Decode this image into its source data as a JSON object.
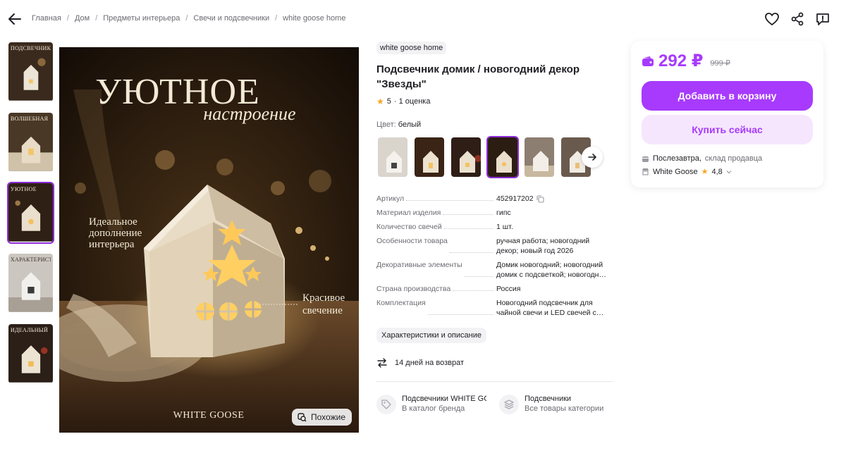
{
  "breadcrumb": [
    "Главная",
    "Дом",
    "Предметы интерьера",
    "Свечи и подсвечники",
    "white goose home"
  ],
  "thumbnails": [
    {
      "caption": "ПОДСВЕЧНИК ДОМИК"
    },
    {
      "caption": "ВОЛШЕБНАЯ"
    },
    {
      "caption": "УЮТНОЕ"
    },
    {
      "caption": "ХАРАКТЕРИСТИКИ"
    },
    {
      "caption": "ИДЕАЛЬНЫЙ"
    }
  ],
  "photo": {
    "headline": "УЮТНОЕ",
    "script": "настроение",
    "left_note": [
      "Идеальное",
      "дополнение",
      "интерьера"
    ],
    "right_note": [
      "Красивое",
      "свечение"
    ],
    "brand_mark": "WHITE GOOSE",
    "similar_label": "Похожие"
  },
  "product": {
    "brand": "white goose home",
    "title": "Подсвечник домик / новогодний декор \"Звезды\"",
    "rating": "5",
    "reviews": "· 1 оценка",
    "color_label": "Цвет:",
    "color_value": "белый",
    "specs": [
      {
        "key": "Артикул",
        "value": "452917202"
      },
      {
        "key": "Материал изделия",
        "value": "гипс"
      },
      {
        "key": "Количество свечей",
        "value": "1 шт."
      },
      {
        "key": "Особенности товара",
        "value": "ручная работа; новогодний декор; новый год 2026"
      },
      {
        "key": "Декоративные элементы",
        "value": "Домик новогодний; новогодний домик с подсветкой; новогодний декор"
      },
      {
        "key": "Страна производства",
        "value": "Россия"
      },
      {
        "key": "Комплектация",
        "value": "Новогодний подсвечник для чайной свечи и LED свечей с батарейкой"
      }
    ],
    "chars_button": "Характеристики и описание",
    "return_text": "14 дней на возврат",
    "categories": [
      {
        "title": "Подсвечники WHITE GOOSE",
        "subtitle": "В каталог бренда"
      },
      {
        "title": "Подсвечники",
        "subtitle": "Все товары категории"
      }
    ]
  },
  "buy": {
    "price": "292 ₽",
    "old_price": "999 ₽",
    "cart_label": "Добавить в корзину",
    "buy_now_label": "Купить сейчас",
    "delivery_date": "Послезавтра,",
    "delivery_from": "склад продавца",
    "seller_name": "White Goose",
    "seller_rating": "4,8"
  },
  "colors": {
    "accent": "#a73afd",
    "accent_light": "#f6e6fd",
    "active_border": "#8f2cd8",
    "star": "#f5a623"
  }
}
